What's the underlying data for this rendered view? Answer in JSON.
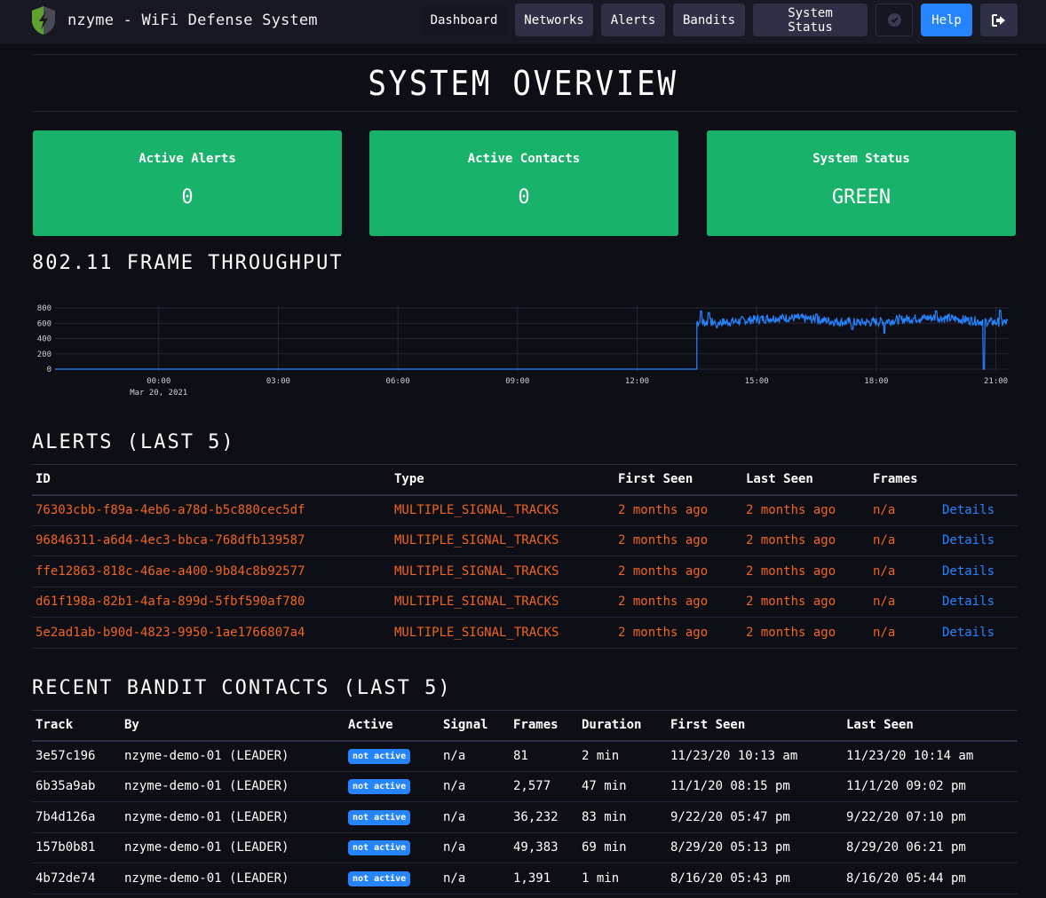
{
  "app": {
    "title": "nzyme - WiFi Defense System",
    "logo_icon": "shield-bolt-icon"
  },
  "nav": {
    "items": [
      {
        "label": "Dashboard",
        "active": true
      },
      {
        "label": "Networks"
      },
      {
        "label": "Alerts"
      },
      {
        "label": "Bandits"
      },
      {
        "label": "System Status"
      }
    ],
    "status_icon": "check-circle-icon",
    "help_label": "Help",
    "logout_icon": "sign-out-icon"
  },
  "page": {
    "title": "SYSTEM OVERVIEW"
  },
  "cards": [
    {
      "title": "Active Alerts",
      "value": "0"
    },
    {
      "title": "Active Contacts",
      "value": "0"
    },
    {
      "title": "System Status",
      "value": "GREEN"
    }
  ],
  "colors": {
    "card_green": "#19b26b",
    "accent_blue": "#2684ff",
    "alert_orange": "#f0651f",
    "background": "#0e0e17",
    "navbar": "#181825"
  },
  "throughput": {
    "title": "802.11 FRAME THROUGHPUT"
  },
  "chart_data": {
    "type": "line",
    "title": "802.11 FRAME THROUGHPUT",
    "xlabel": "",
    "ylabel": "",
    "ylim": [
      0,
      800
    ],
    "yticks": [
      "0",
      "200",
      "400",
      "600",
      "800"
    ],
    "xticks": [
      "00:00",
      "03:00",
      "06:00",
      "09:00",
      "12:00",
      "15:00",
      "18:00",
      "21:00"
    ],
    "xtick_sublabel": "Mar 20, 2021",
    "x_range_hours": [
      -2.6,
      21.3
    ],
    "grid": true,
    "legend": "none",
    "series": [
      {
        "name": "frames",
        "color": "#2684ff",
        "segments": [
          {
            "from_h": -2.6,
            "to_h": 13.5,
            "value": 0
          },
          {
            "from_h": 13.5,
            "to_h": 21.3,
            "mean": 640,
            "noise": 60,
            "peaks": [
              [
                13.6,
                760
              ],
              [
                13.8,
                740
              ],
              [
                16.5,
                720
              ],
              [
                19.5,
                760
              ],
              [
                21.1,
                770
              ]
            ],
            "dips": [
              [
                14.0,
                540
              ],
              [
                17.4,
                520
              ],
              [
                18.2,
                470
              ],
              [
                20.7,
                0
              ]
            ]
          }
        ]
      }
    ]
  },
  "alerts": {
    "title": "ALERTS (LAST 5)",
    "columns": [
      "ID",
      "Type",
      "First Seen",
      "Last Seen",
      "Frames",
      ""
    ],
    "rows": [
      {
        "id": "76303cbb-f89a-4eb6-a78d-b5c880cec5df",
        "type": "MULTIPLE_SIGNAL_TRACKS",
        "first_seen": "2 months ago",
        "last_seen": "2 months ago",
        "frames": "n/a",
        "link": "Details"
      },
      {
        "id": "96846311-a6d4-4ec3-bbca-768dfb139587",
        "type": "MULTIPLE_SIGNAL_TRACKS",
        "first_seen": "2 months ago",
        "last_seen": "2 months ago",
        "frames": "n/a",
        "link": "Details"
      },
      {
        "id": "ffe12863-818c-46ae-a400-9b84c8b92577",
        "type": "MULTIPLE_SIGNAL_TRACKS",
        "first_seen": "2 months ago",
        "last_seen": "2 months ago",
        "frames": "n/a",
        "link": "Details"
      },
      {
        "id": "d61f198a-82b1-4afa-899d-5fbf590af780",
        "type": "MULTIPLE_SIGNAL_TRACKS",
        "first_seen": "2 months ago",
        "last_seen": "2 months ago",
        "frames": "n/a",
        "link": "Details"
      },
      {
        "id": "5e2ad1ab-b90d-4823-9950-1ae1766807a4",
        "type": "MULTIPLE_SIGNAL_TRACKS",
        "first_seen": "2 months ago",
        "last_seen": "2 months ago",
        "frames": "n/a",
        "link": "Details"
      }
    ]
  },
  "bandits": {
    "title": "RECENT BANDIT CONTACTS (LAST 5)",
    "columns": [
      "Track",
      "By",
      "Active",
      "Signal",
      "Frames",
      "Duration",
      "First Seen",
      "Last Seen"
    ],
    "rows": [
      {
        "track": "3e57c196",
        "by": "nzyme-demo-01 (LEADER)",
        "active": "not active",
        "signal": "n/a",
        "frames": "81",
        "duration": "2 min",
        "first_seen": "11/23/20 10:13 am",
        "last_seen": "11/23/20 10:14 am"
      },
      {
        "track": "6b35a9ab",
        "by": "nzyme-demo-01 (LEADER)",
        "active": "not active",
        "signal": "n/a",
        "frames": "2,577",
        "duration": "47 min",
        "first_seen": "11/1/20 08:15 pm",
        "last_seen": "11/1/20 09:02 pm"
      },
      {
        "track": "7b4d126a",
        "by": "nzyme-demo-01 (LEADER)",
        "active": "not active",
        "signal": "n/a",
        "frames": "36,232",
        "duration": "83 min",
        "first_seen": "9/22/20 05:47 pm",
        "last_seen": "9/22/20 07:10 pm"
      },
      {
        "track": "157b0b81",
        "by": "nzyme-demo-01 (LEADER)",
        "active": "not active",
        "signal": "n/a",
        "frames": "49,383",
        "duration": "69 min",
        "first_seen": "8/29/20 05:13 pm",
        "last_seen": "8/29/20 06:21 pm"
      },
      {
        "track": "4b72de74",
        "by": "nzyme-demo-01 (LEADER)",
        "active": "not active",
        "signal": "n/a",
        "frames": "1,391",
        "duration": "1 min",
        "first_seen": "8/16/20 05:43 pm",
        "last_seen": "8/16/20 05:44 pm"
      }
    ]
  }
}
